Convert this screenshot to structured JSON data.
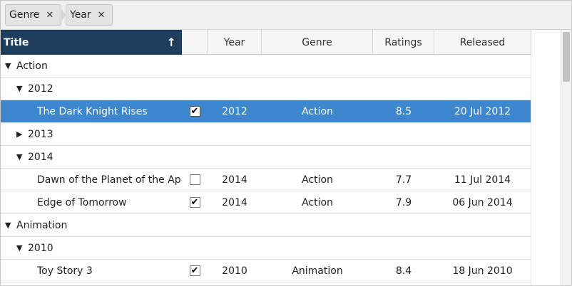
{
  "group_panel": {
    "chips": [
      {
        "label": "Genre",
        "remove_icon": "close-icon"
      },
      {
        "label": "Year",
        "remove_icon": "close-icon"
      }
    ]
  },
  "columns": {
    "title": "Title",
    "title_sort_icon": "arrow-up-icon",
    "year": "Year",
    "genre": "Genre",
    "ratings": "Ratings",
    "released": "Released"
  },
  "rows": [
    {
      "type": "group",
      "level": 1,
      "expanded": true,
      "label": "Action"
    },
    {
      "type": "group",
      "level": 2,
      "expanded": true,
      "label": "2012"
    },
    {
      "type": "data",
      "selected": true,
      "title": "The Dark Knight Rises",
      "checked": true,
      "year": "2012",
      "genre": "Action",
      "rating": "8.5",
      "released": "20 Jul 2012"
    },
    {
      "type": "group",
      "level": 2,
      "expanded": false,
      "label": "2013"
    },
    {
      "type": "group",
      "level": 2,
      "expanded": true,
      "label": "2014"
    },
    {
      "type": "data",
      "selected": false,
      "title": "Dawn of the Planet of the Ap",
      "checked": false,
      "year": "2014",
      "genre": "Action",
      "rating": "7.7",
      "released": "11 Jul 2014"
    },
    {
      "type": "data",
      "selected": false,
      "title": "Edge of Tomorrow",
      "checked": true,
      "year": "2014",
      "genre": "Action",
      "rating": "7.9",
      "released": "06 Jun 2014"
    },
    {
      "type": "group",
      "level": 1,
      "expanded": true,
      "label": "Animation"
    },
    {
      "type": "group",
      "level": 2,
      "expanded": true,
      "label": "2010"
    },
    {
      "type": "data",
      "selected": false,
      "title": "Toy Story 3",
      "checked": true,
      "year": "2010",
      "genre": "Animation",
      "rating": "8.4",
      "released": "18 Jun 2010"
    }
  ],
  "colors": {
    "header_sorted_bg": "#1f3d5c",
    "selected_row_bg": "#3d87cf"
  },
  "glyphs": {
    "close": "✕",
    "sort_up": "🡑",
    "expanded": "▼",
    "collapsed": "▶",
    "check": "✔"
  }
}
